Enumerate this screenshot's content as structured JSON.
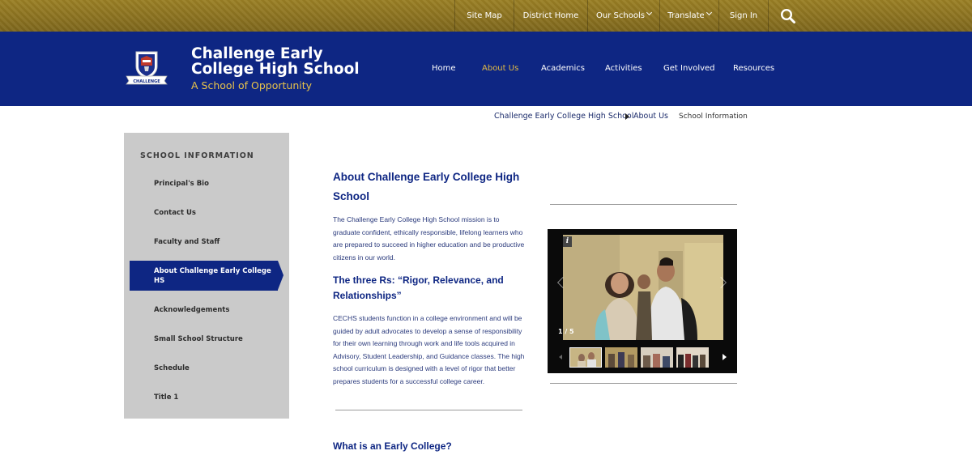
{
  "utility_nav": {
    "items": [
      {
        "label": "Site Map"
      },
      {
        "label": "District Home"
      },
      {
        "label": "Our Schools"
      },
      {
        "label": "Translate"
      },
      {
        "label": "Sign In"
      }
    ],
    "search_icon": "search-icon"
  },
  "header": {
    "school_name": "Challenge Early College High School",
    "tagline": "A School of Opportunity",
    "logo_label": "CHALLENGE",
    "colors": {
      "primary": "#0e2683",
      "gold": "#e2bb45",
      "topbar": "#8b7220"
    }
  },
  "main_nav": {
    "items": [
      {
        "label": "Home"
      },
      {
        "label": "About Us"
      },
      {
        "label": "Academics"
      },
      {
        "label": "Activities"
      },
      {
        "label": "Get Involved"
      },
      {
        "label": "Resources"
      }
    ],
    "active": "About Us"
  },
  "breadcrumb": {
    "items": [
      "Challenge Early College High School",
      "About Us",
      "School Information"
    ]
  },
  "sidebar": {
    "title": "SCHOOL INFORMATION",
    "items": [
      {
        "label": "Principal's Bio"
      },
      {
        "label": "Contact Us"
      },
      {
        "label": "Faculty and Staff"
      },
      {
        "label": "About Challenge Early College HS"
      },
      {
        "label": "Acknowledgements"
      },
      {
        "label": "Small School Structure"
      },
      {
        "label": "Schedule"
      },
      {
        "label": "Title 1"
      }
    ],
    "active": "About Challenge Early College HS"
  },
  "content": {
    "heading": "About Challenge Early College High School",
    "mission": "The Challenge Early College High School mission is to graduate confident, ethically responsible, lifelong learners who are prepared to succeed in higher education and be productive citizens in our world.",
    "three_rs_heading": "The three Rs: “Rigor, Relevance, and Relationships”",
    "three_rs_body": "CECHS students function in a college environment and will be guided by adult advocates to develop a sense of responsibility for their own learning through work and life tools acquired in Advisory, Student Leadership, and Guidance classes. The high school curriculum is designed with a level of rigor that better prepares students for a successful college career.",
    "early_college_heading": "What is an Early College?"
  },
  "gallery": {
    "info_icon_label": "i",
    "counter": "1 / 5",
    "thumbnails": 4
  }
}
